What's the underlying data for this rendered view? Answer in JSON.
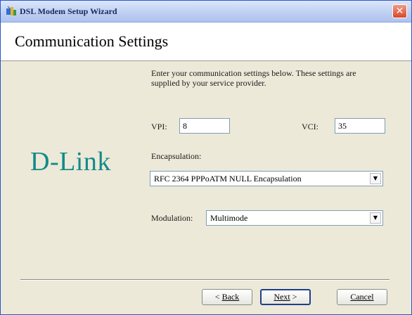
{
  "window": {
    "title": "DSL Modem Setup Wizard",
    "icon": "app-icon",
    "close_glyph": "✕"
  },
  "header": {
    "title": "Communication Settings"
  },
  "brand": {
    "logo_text": "D-Link",
    "color": "#138a8a"
  },
  "form": {
    "instructions": "Enter your communication settings below.  These settings are supplied by your service provider.",
    "vpi_label": "VPI:",
    "vpi_value": "8",
    "vci_label": "VCI:",
    "vci_value": "35",
    "encapsulation_label": "Encapsulation:",
    "encapsulation_value": "RFC 2364 PPPoATM NULL Encapsulation",
    "modulation_label": "Modulation:",
    "modulation_value": "Multimode"
  },
  "buttons": {
    "back_prefix": "< ",
    "back_label": "Back",
    "next_label": "Next",
    "next_suffix": " >",
    "cancel_label": "Cancel"
  }
}
